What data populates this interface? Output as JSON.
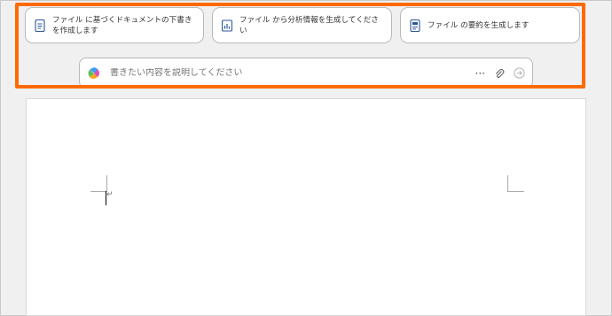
{
  "prompts": [
    {
      "icon": "document-icon",
      "label": "ファイル に基づくドキュメントの下書きを作成します"
    },
    {
      "icon": "chart-icon",
      "label": "ファイル から分析情報を生成してください"
    },
    {
      "icon": "summary-doc-icon",
      "label": "ファイル の要約を生成します"
    }
  ],
  "chat": {
    "placeholder": "書きたい内容を説明してください",
    "more_label": "···"
  },
  "document": {
    "paragraph_mark": "↵"
  },
  "colors": {
    "highlight": "#ff6a00",
    "accent_blue": "#2b579a"
  }
}
